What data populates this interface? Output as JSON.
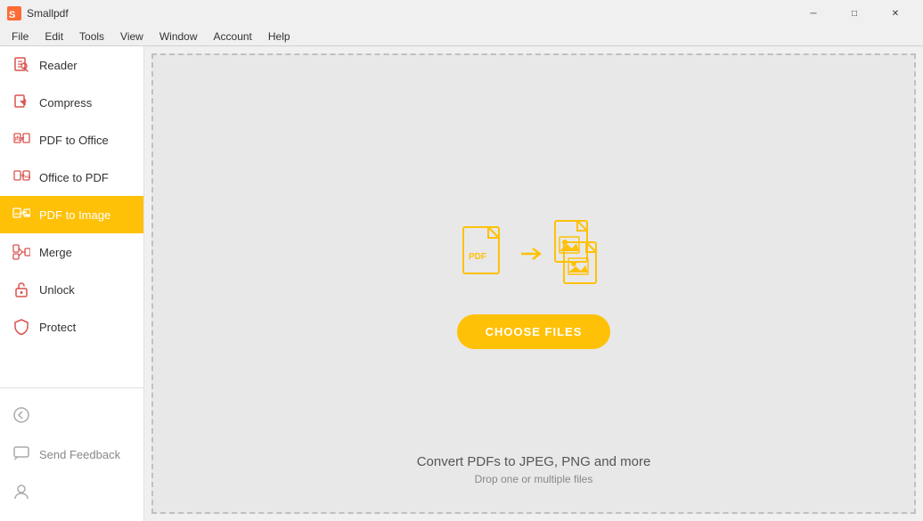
{
  "app": {
    "title": "Smallpdf",
    "icon_color": "#e63946"
  },
  "titlebar": {
    "minimize_label": "─",
    "maximize_label": "□",
    "close_label": "✕"
  },
  "menubar": {
    "items": [
      {
        "label": "File"
      },
      {
        "label": "Edit"
      },
      {
        "label": "Tools"
      },
      {
        "label": "View"
      },
      {
        "label": "Window"
      },
      {
        "label": "Account"
      },
      {
        "label": "Help"
      }
    ]
  },
  "sidebar": {
    "nav_items": [
      {
        "id": "reader",
        "label": "Reader",
        "active": false
      },
      {
        "id": "compress",
        "label": "Compress",
        "active": false
      },
      {
        "id": "pdf-to-office",
        "label": "PDF to Office",
        "active": false
      },
      {
        "id": "office-to-pdf",
        "label": "Office to PDF",
        "active": false
      },
      {
        "id": "pdf-to-image",
        "label": "PDF to Image",
        "active": true
      },
      {
        "id": "merge",
        "label": "Merge",
        "active": false
      },
      {
        "id": "unlock",
        "label": "Unlock",
        "active": false
      },
      {
        "id": "protect",
        "label": "Protect",
        "active": false
      }
    ],
    "bottom_items": [
      {
        "id": "back",
        "label": ""
      },
      {
        "id": "send-feedback",
        "label": "Send Feedback"
      },
      {
        "id": "account",
        "label": ""
      }
    ]
  },
  "content": {
    "choose_files_label": "CHOOSE FILES",
    "caption_main": "Convert PDFs to JPEG, PNG and more",
    "caption_sub": "Drop one or multiple files"
  }
}
